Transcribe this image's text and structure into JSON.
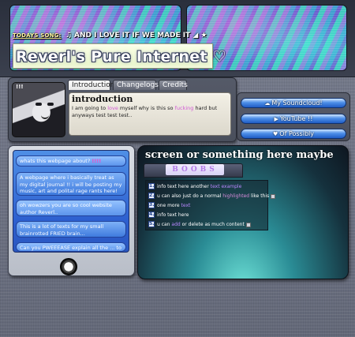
{
  "header": {
    "ticker_label": "TODAYS SONG:",
    "ticker_icon": "♫",
    "ticker_text": "AND I LOVE IT IF WE MADE IT",
    "ticker_trailing_icons": "◢ ★",
    "site_title": "Reverl's Pure Internet ♡"
  },
  "intro": {
    "tabs": [
      {
        "label": "Introduction",
        "active": true
      },
      {
        "label": "Changelogs",
        "active": false
      },
      {
        "label": "Credits",
        "active": false
      }
    ],
    "heading": "introduction",
    "body_part1": "I am going to ",
    "body_emph": "love",
    "body_part2": " myself why is this so ",
    "body_emph2": "fucking",
    "body_part3": " hard but anyways test test test..",
    "avatar_label": "!!!"
  },
  "links": [
    {
      "label": "My Soundcloud!",
      "icon": "cloud-icon"
    },
    {
      "label": "YouTube !!",
      "icon": "youtube-icon"
    },
    {
      "label": "Of Possibly",
      "icon": "heart-icon"
    }
  ],
  "chat": {
    "messages": [
      {
        "type": "q",
        "text": "whats this webpage about?",
        "accent": "!!!!"
      },
      {
        "type": "a",
        "text": "A webpage where i basically treat as my digital journal !! i will be posting my music, art and polital rage rants here!"
      },
      {
        "type": "q",
        "text": "oh wowzers you are so cool website author Reverl.."
      },
      {
        "type": "a",
        "text": "This is a lot of texts for my small brainrotted FRIED brain..."
      },
      {
        "type": "q",
        "text": "Can you PWEEEASE explain all the ... to"
      }
    ]
  },
  "main": {
    "heading": "screen or something here maybe",
    "section_label": "BOOBS",
    "list": [
      {
        "num": "1.",
        "parts": [
          {
            "t": "info text here another "
          },
          {
            "t": "text example",
            "c": "purple"
          }
        ]
      },
      {
        "num": "2.",
        "parts": [
          {
            "t": "u can also just do a normal "
          },
          {
            "t": "highlighted",
            "c": "pink"
          },
          {
            "t": " like this "
          }
        ],
        "img": true
      },
      {
        "num": "3.",
        "parts": [
          {
            "t": "one more "
          },
          {
            "t": "text",
            "c": "purple"
          }
        ]
      },
      {
        "num": "4.",
        "parts": [
          {
            "t": "info text here"
          }
        ]
      },
      {
        "num": "5.",
        "parts": [
          {
            "t": "u can "
          },
          {
            "t": "add",
            "c": "purple"
          },
          {
            "t": " or delete as much content "
          }
        ],
        "img": true
      }
    ]
  },
  "colors": {
    "accent_pink": "#d25ad6",
    "link_blue": "#1f5cc4",
    "panel_teal": "#2a8c95"
  }
}
